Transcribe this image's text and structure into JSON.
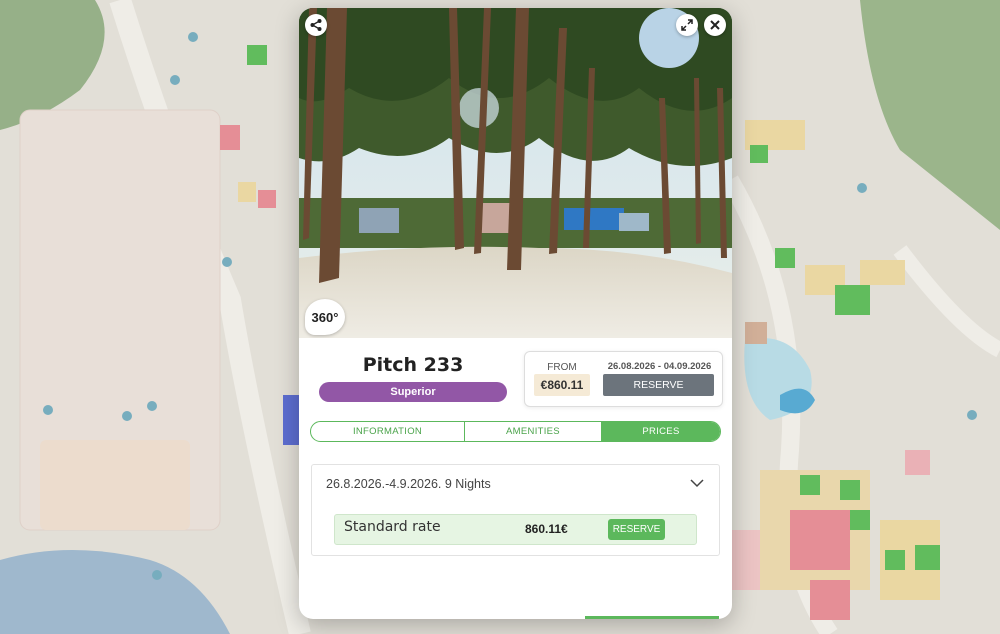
{
  "pitch": {
    "title": "Pitch 233",
    "category": "Superior",
    "badge_360": "360°"
  },
  "price_box": {
    "from_label": "FROM",
    "from_price": "€860.11",
    "date_range": "26.08.2026 - 04.09.2026",
    "reserve_label": "RESERVE"
  },
  "tabs": [
    {
      "label": "INFORMATION",
      "active": false
    },
    {
      "label": "AMENITIES",
      "active": false
    },
    {
      "label": "PRICES",
      "active": true
    }
  ],
  "period": {
    "heading": "26.8.2026.-4.9.2026. 9 Nights",
    "rates": [
      {
        "name": "Standard rate",
        "price": "860.11€",
        "reserve_label": "RESERVE"
      }
    ]
  },
  "icons": {
    "share": "share-icon",
    "expand": "expand-icon",
    "close": "close-icon",
    "chevron": "chevron-down-icon"
  },
  "colors": {
    "category_purple": "#9257a6",
    "accent_green": "#5cb85c",
    "reserve_gray": "#6c747c"
  }
}
